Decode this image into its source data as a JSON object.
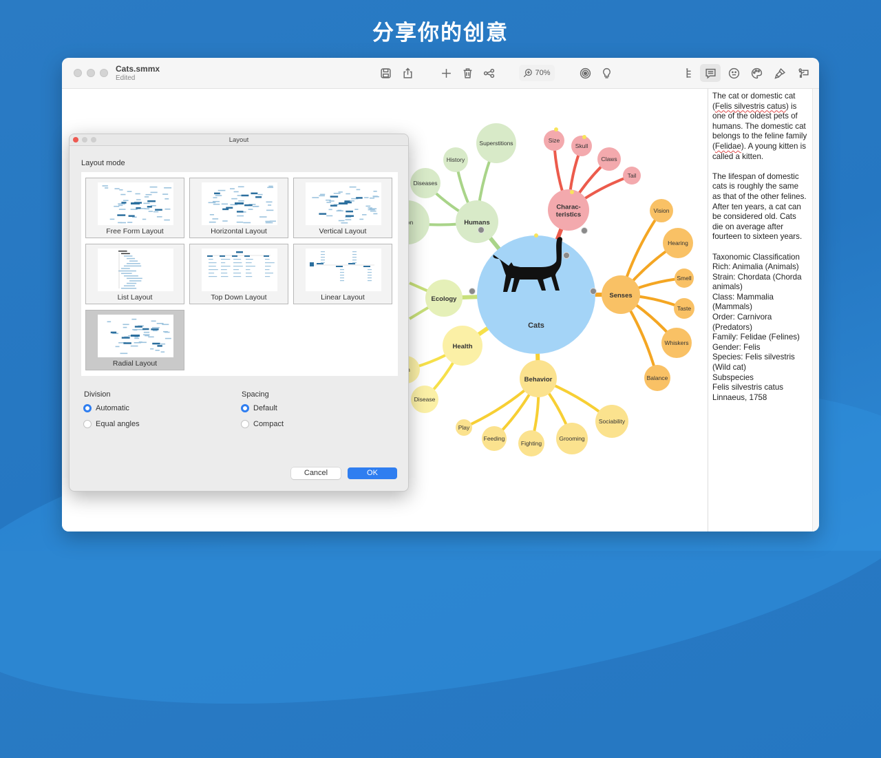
{
  "headline": "分享你的创意",
  "window": {
    "doc_name": "Cats.smmx",
    "doc_status": "Edited",
    "toolbar": {
      "zoom_level": "70%",
      "icons": [
        "save-icon",
        "share-icon",
        "add-icon",
        "trash-icon",
        "connect-icon",
        "zoom-icon",
        "focus-icon",
        "lightbulb-icon",
        "outline-icon",
        "notes-icon",
        "emoji-icon",
        "palette-icon",
        "brush-icon",
        "presentation-icon"
      ]
    }
  },
  "mindmap": {
    "central": {
      "label": "Cats",
      "color": "#a4d4f7"
    },
    "branches": [
      {
        "label": "Humans",
        "color": "#d8eac8",
        "line": "#a9d489",
        "children": [
          "Superstitions",
          "History",
          "Diseases",
          "...on"
        ]
      },
      {
        "label": "Charac-\nteristics",
        "color": "#f3a9ad",
        "line": "#ec5b4c",
        "children": [
          "Size",
          "Skull",
          "Claws",
          "Tail"
        ]
      },
      {
        "label": "Senses",
        "color": "#f9c165",
        "line": "#f4a623",
        "children": [
          "Vision",
          "Hearing",
          "Smell",
          "Taste",
          "Whiskers",
          "Balance"
        ]
      },
      {
        "label": "Behavior",
        "color": "#fbe28e",
        "line": "#f7cf34",
        "children": [
          "Play",
          "Feeding",
          "Fighting",
          "Grooming",
          "Sociability"
        ]
      },
      {
        "label": "Health",
        "color": "#fbf0a6",
        "line": "#f6e04a",
        "children": [
          "Disease",
          "...n"
        ]
      },
      {
        "label": "Ecology",
        "color": "#e5f0b8",
        "line": "#c8e07a",
        "children": []
      }
    ]
  },
  "notes": {
    "paragraphs": [
      "The cat or domestic cat (Felis silvestris catus) is one of the oldest pets of humans. The domestic cat belongs to the feline family (Felidae). A young kitten is called a kitten.",
      "The lifespan of domestic cats is roughly the same as that of the other felines. After ten years, a cat can be considered old. Cats die on average after fourteen to sixteen years.",
      "Taxonomic Classification\nRich: Animalia (Animals)\nStrain: Chordata (Chorda animals)\nClass: Mammalia (Mammals)\nOrder: Carnivora (Predators)\nFamily: Felidae (Felines)\nGender: Felis\nSpecies: Felis silvestris (Wild cat)\nSubspecies\nFelis silvestris catus\nLinnaeus, 1758"
    ]
  },
  "dialog": {
    "title": "Layout",
    "layout_mode_label": "Layout mode",
    "layouts": [
      {
        "label": "Free Form Layout",
        "selected": false
      },
      {
        "label": "Horizontal Layout",
        "selected": false
      },
      {
        "label": "Vertical Layout",
        "selected": false
      },
      {
        "label": "List Layout",
        "selected": false
      },
      {
        "label": "Top Down Layout",
        "selected": false
      },
      {
        "label": "Linear Layout",
        "selected": false
      },
      {
        "label": "Radial Layout",
        "selected": true
      }
    ],
    "division": {
      "label": "Division",
      "options": [
        {
          "label": "Automatic",
          "checked": true
        },
        {
          "label": "Equal angles",
          "checked": false
        }
      ]
    },
    "spacing": {
      "label": "Spacing",
      "options": [
        {
          "label": "Default",
          "checked": true
        },
        {
          "label": "Compact",
          "checked": false
        }
      ]
    },
    "cancel_label": "Cancel",
    "ok_label": "OK",
    "accent": "#2f7ef0"
  }
}
